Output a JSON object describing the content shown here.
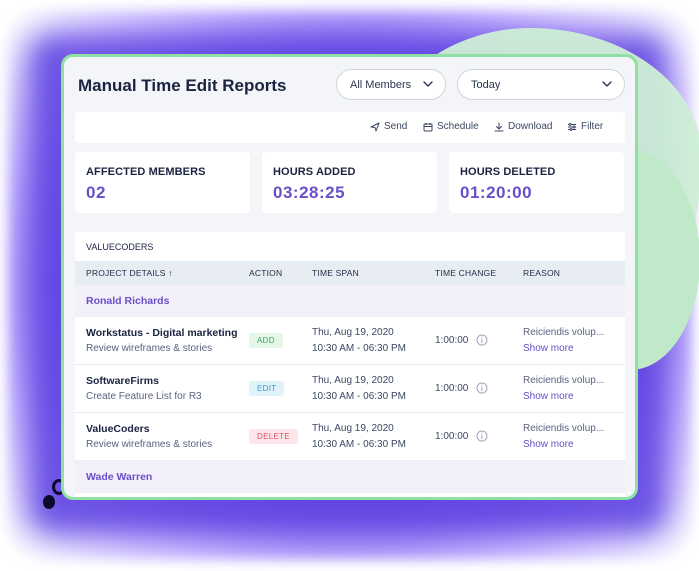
{
  "header": {
    "title": "Manual Time Edit Reports",
    "members_select": "All Members",
    "date_select": "Today"
  },
  "toolbar": {
    "send": "Send",
    "schedule": "Schedule",
    "download": "Download",
    "filter": "Filter"
  },
  "stats": [
    {
      "label": "AFFECTED MEMBERS",
      "value": "02"
    },
    {
      "label": "HOURS ADDED",
      "value": "03:28:25"
    },
    {
      "label": "HOURS DELETED",
      "value": "01:20:00"
    }
  ],
  "table": {
    "title": "VALUECODERS",
    "columns": [
      "PROJECT DETAILS ↑",
      "ACTION",
      "TIME SPAN",
      "TIME CHANGE",
      "REASON"
    ],
    "groups": [
      {
        "name": "Ronald Richards"
      },
      {
        "name": "Wade Warren"
      }
    ],
    "rows": [
      {
        "project": "Workstatus - Digital marketing",
        "task": "Review wireframes & stories",
        "action": "ADD",
        "date": "Thu, Aug 19, 2020",
        "time": "10:30 AM - 06:30 PM",
        "change": "1:00:00",
        "reason": "Reiciendis volup...",
        "more": "Show more"
      },
      {
        "project": "SoftwareFirms",
        "task": "Create Feature List for R3",
        "action": "EDIT",
        "date": "Thu, Aug 19, 2020",
        "time": "10:30 AM - 06:30 PM",
        "change": "1:00:00",
        "reason": "Reiciendis volup...",
        "more": "Show more"
      },
      {
        "project": "ValueCoders",
        "task": "Review wireframes & stories",
        "action": "DELETE",
        "date": "Thu, Aug 19, 2020",
        "time": "10:30 AM - 06:30 PM",
        "change": "1:00:00",
        "reason": "Reiciendis volup...",
        "more": "Show more"
      }
    ]
  },
  "colors": {
    "accent": "#6a4fc8",
    "card_border": "#8fe0a3",
    "add": "#3ba55c",
    "edit": "#2d9cc9",
    "delete": "#e2506b"
  },
  "icons": [
    "chevron-down-icon",
    "send-icon",
    "schedule-icon",
    "download-icon",
    "filter-icon",
    "info-icon"
  ]
}
